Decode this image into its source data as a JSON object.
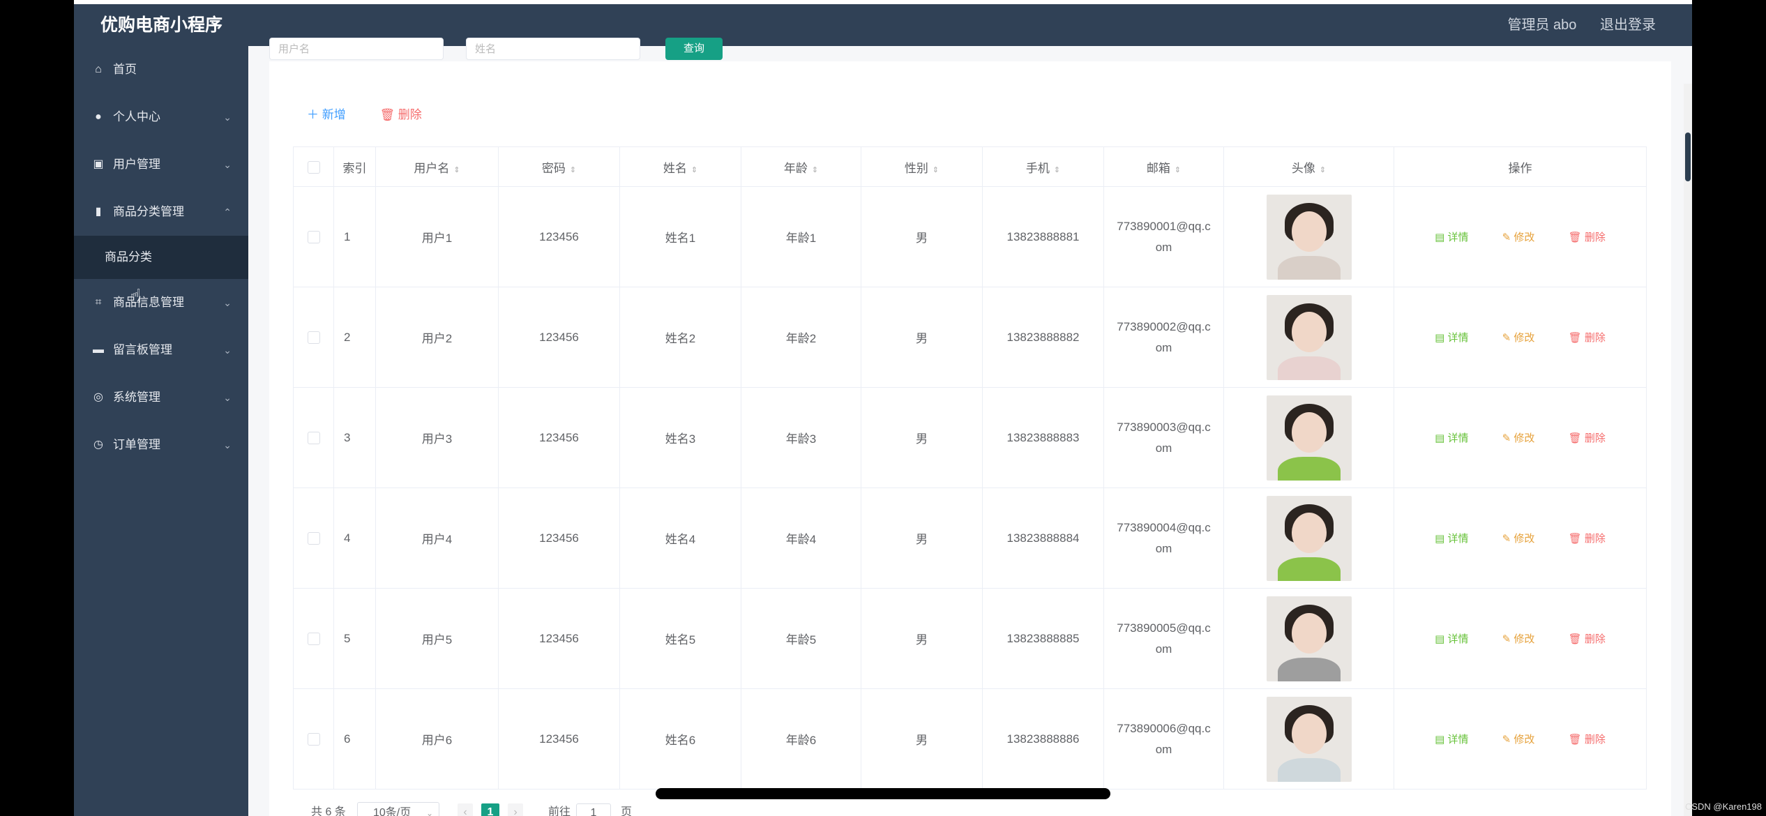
{
  "app": {
    "title": "优购电商小程序",
    "admin_label": "管理员 abo",
    "logout_label": "退出登录"
  },
  "sidebar": {
    "items": [
      {
        "icon": "home-icon",
        "label": "首页",
        "chev": ""
      },
      {
        "icon": "user-icon",
        "label": "个人中心",
        "chev": "⌄"
      },
      {
        "icon": "users-icon",
        "label": "用户管理",
        "chev": "⌄"
      },
      {
        "icon": "bar-chart-icon",
        "label": "商品分类管理",
        "chev": "⌃"
      }
    ],
    "submenu": {
      "label": "商品分类"
    },
    "items2": [
      {
        "icon": "crop-icon",
        "label": "商品信息管理",
        "chev": "⌄"
      },
      {
        "icon": "board-icon",
        "label": "留言板管理",
        "chev": "⌄"
      },
      {
        "icon": "globe-icon",
        "label": "系统管理",
        "chev": "⌄"
      },
      {
        "icon": "clock-icon",
        "label": "订单管理",
        "chev": "⌄"
      }
    ]
  },
  "search": {
    "input1_placeholder": "用户名",
    "input2_placeholder": "姓名",
    "button_label": "查询"
  },
  "toolbar": {
    "add_label": "新增",
    "delete_label": "删除"
  },
  "table": {
    "headers": [
      "索引",
      "用户名",
      "密码",
      "姓名",
      "年龄",
      "性别",
      "手机",
      "邮箱",
      "头像",
      "操作"
    ],
    "rows": [
      {
        "idx": "1",
        "username": "用户1",
        "password": "123456",
        "name": "姓名1",
        "age": "年龄1",
        "gender": "男",
        "phone": "13823888881",
        "email_a": "773890001@qq.c",
        "email_b": "om",
        "avatar_color": "#d9cfc8"
      },
      {
        "idx": "2",
        "username": "用户2",
        "password": "123456",
        "name": "姓名2",
        "age": "年龄2",
        "gender": "男",
        "phone": "13823888882",
        "email_a": "773890002@qq.c",
        "email_b": "om",
        "avatar_color": "#e8d2d0"
      },
      {
        "idx": "3",
        "username": "用户3",
        "password": "123456",
        "name": "姓名3",
        "age": "年龄3",
        "gender": "男",
        "phone": "13823888883",
        "email_a": "773890003@qq.c",
        "email_b": "om",
        "avatar_color": "#8bc34a"
      },
      {
        "idx": "4",
        "username": "用户4",
        "password": "123456",
        "name": "姓名4",
        "age": "年龄4",
        "gender": "男",
        "phone": "13823888884",
        "email_a": "773890004@qq.c",
        "email_b": "om",
        "avatar_color": "#8bc34a"
      },
      {
        "idx": "5",
        "username": "用户5",
        "password": "123456",
        "name": "姓名5",
        "age": "年龄5",
        "gender": "男",
        "phone": "13823888885",
        "email_a": "773890005@qq.c",
        "email_b": "om",
        "avatar_color": "#9e9e9e"
      },
      {
        "idx": "6",
        "username": "用户6",
        "password": "123456",
        "name": "姓名6",
        "age": "年龄6",
        "gender": "男",
        "phone": "13823888886",
        "email_a": "773890006@qq.c",
        "email_b": "om",
        "avatar_color": "#cfd8dc"
      }
    ],
    "ops": {
      "detail": "详情",
      "edit": "修改",
      "remove": "删除"
    }
  },
  "pager": {
    "total": "共 6 条",
    "page_size": "10条/页",
    "current_page": "1",
    "goto_label": "前往",
    "goto_value": "1",
    "unit": "页"
  },
  "watermark": "CSDN @Karen198",
  "colors": {
    "sidebar": "#304156",
    "accent": "#16a085",
    "add": "#409eff",
    "delete": "#f56c6c",
    "detail": "#67c23a",
    "edit": "#e6a23c"
  }
}
